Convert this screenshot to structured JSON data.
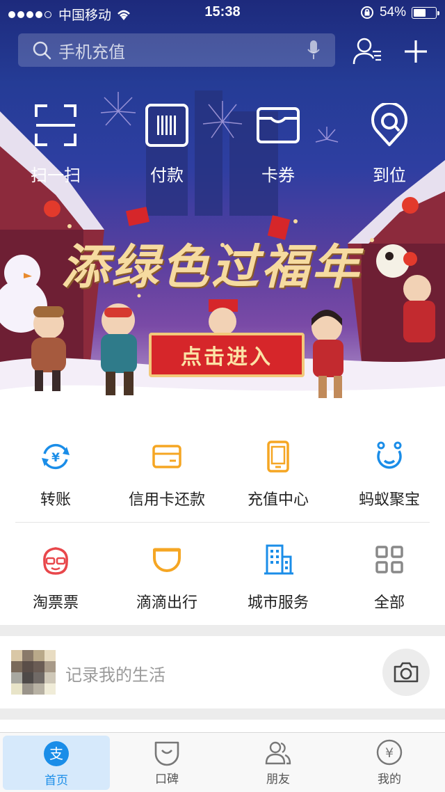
{
  "status_bar": {
    "carrier": "中国移动",
    "time": "15:38",
    "battery": "54%"
  },
  "search": {
    "placeholder": "手机充值"
  },
  "quick_actions": [
    {
      "label": "扫一扫",
      "icon": "scan-icon"
    },
    {
      "label": "付款",
      "icon": "barcode-icon"
    },
    {
      "label": "卡券",
      "icon": "wallet-icon"
    },
    {
      "label": "到位",
      "icon": "location-icon"
    }
  ],
  "banner": {
    "title": "添绿色过福年",
    "button": "点击进入"
  },
  "services": {
    "row1": [
      {
        "label": "转账",
        "icon": "transfer-icon",
        "color": "#1a8de8"
      },
      {
        "label": "信用卡还款",
        "icon": "credit-card-icon",
        "color": "#f5a623"
      },
      {
        "label": "充值中心",
        "icon": "phone-icon",
        "color": "#f5a623"
      },
      {
        "label": "蚂蚁聚宝",
        "icon": "ant-fortune-icon",
        "color": "#1a8de8"
      }
    ],
    "row2": [
      {
        "label": "淘票票",
        "icon": "taopiaopiao-icon",
        "color": "#e8474b"
      },
      {
        "label": "滴滴出行",
        "icon": "didi-icon",
        "color": "#f5a623"
      },
      {
        "label": "城市服务",
        "icon": "city-building-icon",
        "color": "#1a8de8"
      },
      {
        "label": "全部",
        "icon": "grid-icon",
        "color": "#888888"
      }
    ]
  },
  "life_card": {
    "placeholder": "记录我的生活"
  },
  "tabs": [
    {
      "label": "首页",
      "icon": "alipay-icon",
      "active": true
    },
    {
      "label": "口碑",
      "icon": "koubei-icon",
      "active": false
    },
    {
      "label": "朋友",
      "icon": "friends-icon",
      "active": false
    },
    {
      "label": "我的",
      "icon": "yuan-icon",
      "active": false
    }
  ],
  "colors": {
    "hero_top": "#1d2a7c",
    "accent_blue": "#1a8de8",
    "banner_red": "#d6262a"
  }
}
